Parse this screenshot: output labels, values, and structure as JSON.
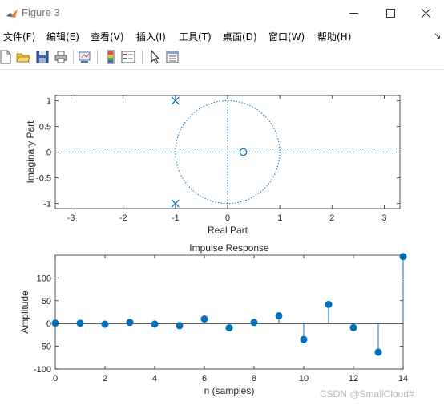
{
  "window": {
    "title": "Figure 3",
    "icons": {
      "app": "matlab-icon",
      "minimize": "minimize-icon",
      "maximize": "maximize-icon",
      "close": "close-icon"
    }
  },
  "menu": {
    "items": [
      "文件(F)",
      "编辑(E)",
      "查看(V)",
      "插入(I)",
      "工具(T)",
      "桌面(D)",
      "窗口(W)",
      "帮助(H)"
    ],
    "overflow": "↘"
  },
  "toolbar": {
    "buttons": [
      "new-figure-icon",
      "open-file-icon",
      "save-icon",
      "print-icon",
      "link-plot-icon",
      "insert-colorbar-icon",
      "insert-legend-icon",
      "pointer-icon",
      "property-editor-icon"
    ]
  },
  "pole_zero": {
    "xlabel": "Real Part",
    "ylabel": "Imaginary Part",
    "xticks": [
      "-3",
      "-2",
      "-1",
      "0",
      "1",
      "2",
      "3"
    ],
    "yticks": [
      "1",
      "0.5",
      "0",
      "-0.5",
      "-1"
    ]
  },
  "impulse": {
    "title": "Impulse Response",
    "xlabel": "n (samples)",
    "ylabel": "Amplitude",
    "xticks": [
      "0",
      "2",
      "4",
      "6",
      "8",
      "10",
      "12",
      "14"
    ],
    "yticks": [
      "100",
      "50",
      "0",
      "-50",
      "-100"
    ]
  },
  "watermark": "CSDN @SmallCloud#",
  "chart_data": [
    {
      "type": "scatter",
      "xlabel": "Real Part",
      "ylabel": "Imaginary Part",
      "xlim": [
        -3.3,
        3.3
      ],
      "ylim": [
        -1.1,
        1.1
      ],
      "unit_circle": true,
      "poles": [
        {
          "re": -1,
          "im": 1
        },
        {
          "re": -1,
          "im": -1
        }
      ],
      "zeros": [
        {
          "re": 0.3,
          "im": 0
        }
      ],
      "color": "#0072BD"
    },
    {
      "type": "stem",
      "title": "Impulse Response",
      "xlabel": "n (samples)",
      "ylabel": "Amplitude",
      "xlim": [
        0,
        14
      ],
      "ylim": [
        -100,
        150
      ],
      "x": [
        0,
        1,
        2,
        3,
        4,
        5,
        6,
        7,
        8,
        9,
        10,
        11,
        12,
        13,
        14
      ],
      "values": [
        1,
        0.6,
        -1.5,
        2.5,
        -1.2,
        -4.5,
        10,
        -9.5,
        2.5,
        17,
        -35,
        42,
        -9,
        -63,
        147
      ],
      "color": "#0072BD"
    }
  ]
}
